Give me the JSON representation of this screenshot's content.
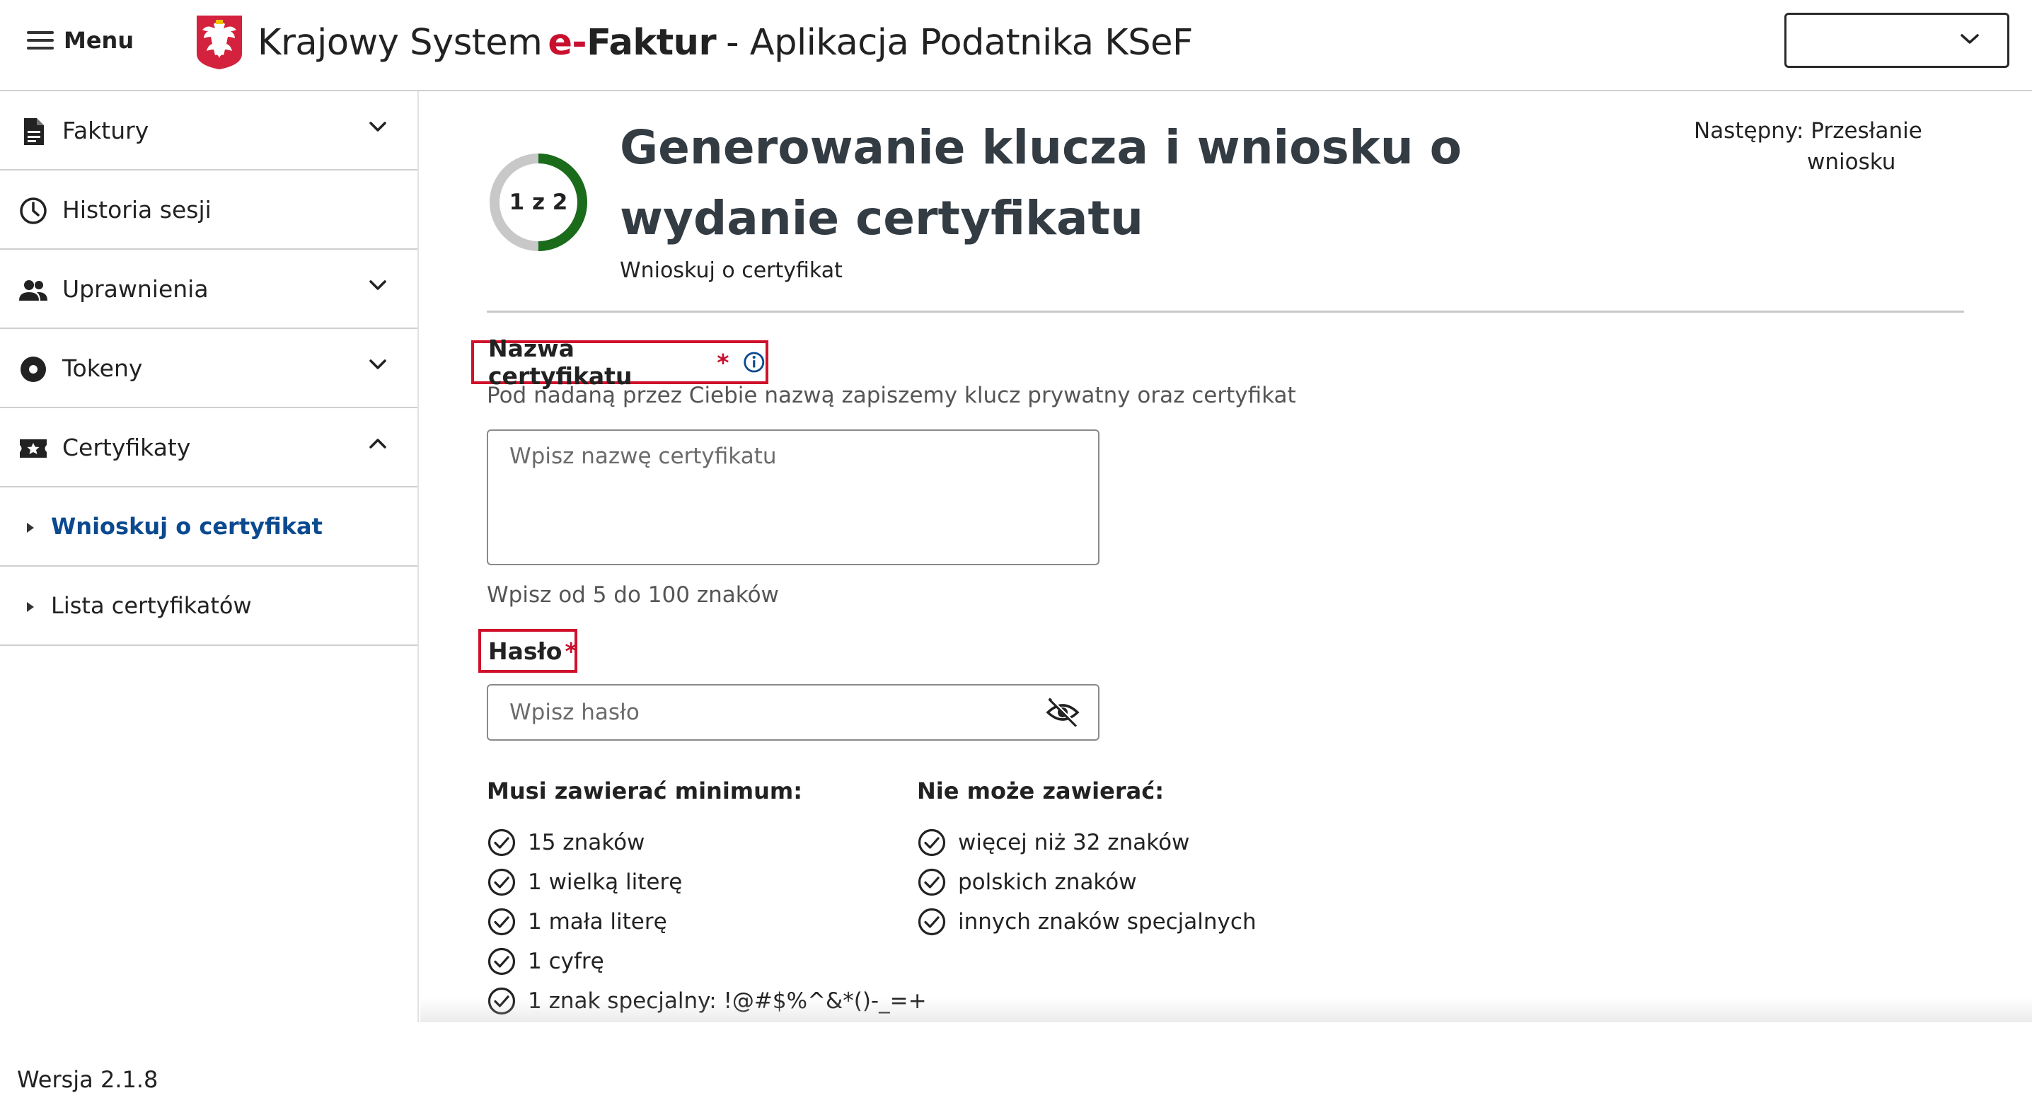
{
  "header": {
    "menu_label": "Menu",
    "title_prefix": "Krajowy System",
    "title_brand_e": "e-",
    "title_brand": "Faktur",
    "title_rest": "- Aplikacja Podatnika KSeF",
    "language_select_value": ""
  },
  "sidebar": {
    "items": [
      {
        "label": "Faktury",
        "icon": "document-icon",
        "expandable": true,
        "expanded": false
      },
      {
        "label": "Historia sesji",
        "icon": "clock-icon",
        "expandable": false
      },
      {
        "label": "Uprawnienia",
        "icon": "people-icon",
        "expandable": true,
        "expanded": false
      },
      {
        "label": "Tokeny",
        "icon": "token-icon",
        "expandable": true,
        "expanded": false
      },
      {
        "label": "Certyfikaty",
        "icon": "certificate-icon",
        "expandable": true,
        "expanded": true
      }
    ],
    "subitems": [
      {
        "label": "Wnioskuj o certyfikat",
        "active": true
      },
      {
        "label": "Lista certyfikatów",
        "active": false
      }
    ],
    "version": "Wersja 2.1.8"
  },
  "main": {
    "progress": {
      "label": "1 z 2",
      "current": 1,
      "total": 2
    },
    "title": "Generowanie klucza i wniosku o wydanie certyfikatu",
    "subtitle": "Wnioskuj o certyfikat",
    "next_label": "Następny:",
    "next_value_1": "Przesłanie",
    "next_value_2": "wniosku",
    "cert_name": {
      "label": "Nazwa certyfikatu",
      "required_mark": "*",
      "description": "Pod nadaną przez Ciebie nazwą zapiszemy klucz prywatny oraz certyfikat",
      "placeholder": "Wpisz nazwę certyfikatu",
      "value": "",
      "hint": "Wpisz od 5 do 100 znaków"
    },
    "password": {
      "label": "Hasło",
      "required_mark": "*",
      "placeholder": "Wpisz hasło",
      "value": ""
    },
    "must_contain": {
      "heading": "Musi zawierać minimum:",
      "items": [
        "15 znaków",
        "1 wielką literę",
        "1 mała literę",
        "1 cyfrę",
        "1 znak specjalny: !@#$%^&*()-_=+"
      ]
    },
    "must_not_contain": {
      "heading": "Nie może zawierać:",
      "items": [
        "więcej niż 32 znaków",
        "polskich znaków",
        "innych znaków specjalnych"
      ]
    }
  },
  "colors": {
    "accent_red": "#c8102e",
    "link_blue": "#0b4a8f",
    "progress_green": "#1a6b1a",
    "progress_track": "#c8c8c8"
  }
}
